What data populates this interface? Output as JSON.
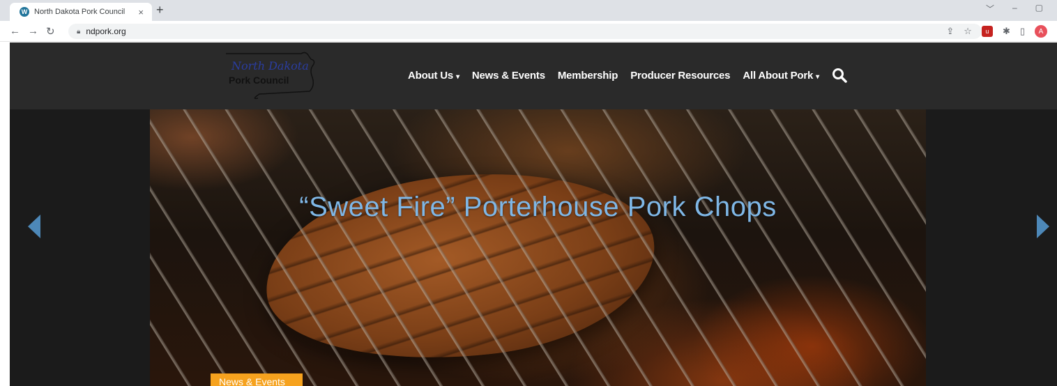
{
  "browser": {
    "tab_title": "North Dakota Pork Council",
    "tab_close": "×",
    "new_tab": "+",
    "url": "ndpork.org",
    "avatar_initial": "A",
    "window_controls": [
      "﹀",
      "–",
      "▢"
    ]
  },
  "site": {
    "logo": {
      "line1": "North Dakota",
      "line2": "Pork Council"
    },
    "nav": [
      {
        "label": "About Us",
        "has_dropdown": true,
        "caret": "▾"
      },
      {
        "label": "News & Events",
        "has_dropdown": false
      },
      {
        "label": "Membership",
        "has_dropdown": false
      },
      {
        "label": "Producer Resources",
        "has_dropdown": false
      },
      {
        "label": "All About Pork",
        "has_dropdown": true,
        "caret": "▾"
      }
    ],
    "hero": {
      "title": "“Sweet Fire” Porterhouse Pork Chops",
      "category": "News & Events"
    }
  },
  "colors": {
    "header_bg": "#2a2a2a",
    "hero_title": "#7fb7e6",
    "badge": "#f6a21e",
    "arrow": "#4d88b8"
  },
  "icons": [
    "wordpress-icon",
    "back-icon",
    "forward-icon",
    "reload-icon",
    "lock-icon",
    "share-icon",
    "bookmark-star-icon",
    "extension-shield-icon",
    "puzzle-icon",
    "sidepanel-icon",
    "search-icon",
    "prev-arrow-icon",
    "next-arrow-icon"
  ]
}
